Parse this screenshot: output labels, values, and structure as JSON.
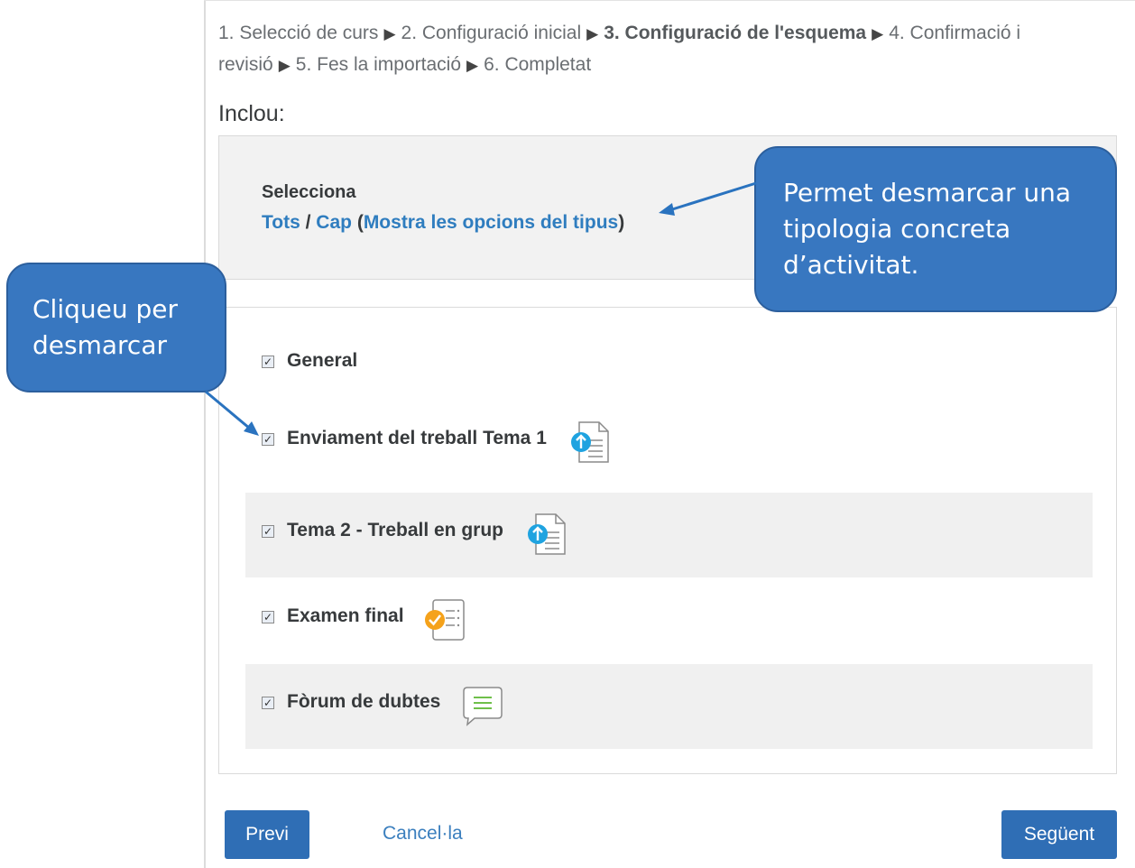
{
  "breadcrumb": {
    "step1": "1. Selecció de curs",
    "step2": "2. Configuració inicial",
    "step3": "3. Configuració de l'esquema",
    "step4": "4. Confirmació i revisió",
    "step5": "5. Fes la importació",
    "step6": "6. Completat",
    "separator": "▶"
  },
  "include_heading": "Inclou:",
  "selection": {
    "title": "Selecciona",
    "all": "Tots",
    "slash": " / ",
    "none": "Cap",
    "open_paren": " (",
    "type_options": "Mostra les opcions del tipus",
    "close_paren": ")"
  },
  "items": [
    {
      "label": "General",
      "checked": true,
      "icon": null
    },
    {
      "label": "Enviament del treball Tema 1",
      "checked": true,
      "icon": "assignment-icon"
    },
    {
      "label": "Tema 2 - Treball en grup",
      "checked": true,
      "icon": "assignment-icon"
    },
    {
      "label": "Examen final",
      "checked": true,
      "icon": "quiz-icon"
    },
    {
      "label": "Fòrum de dubtes",
      "checked": true,
      "icon": "forum-icon"
    }
  ],
  "buttons": {
    "prev": "Previ",
    "cancel": "Cancel·la",
    "next": "Següent"
  },
  "callouts": {
    "type_options_note": "Permet desmarcar una tipologia concreta d’activitat.",
    "uncheck_note": "Cliqueu per desmarcar"
  },
  "colors": {
    "accent": "#2f6eb5",
    "link": "#2f7dbf",
    "callout": "#3877c0",
    "assignment_badge": "#1fa3e0",
    "quiz_badge": "#f5a21b",
    "forum_lines": "#6fbf4a"
  }
}
